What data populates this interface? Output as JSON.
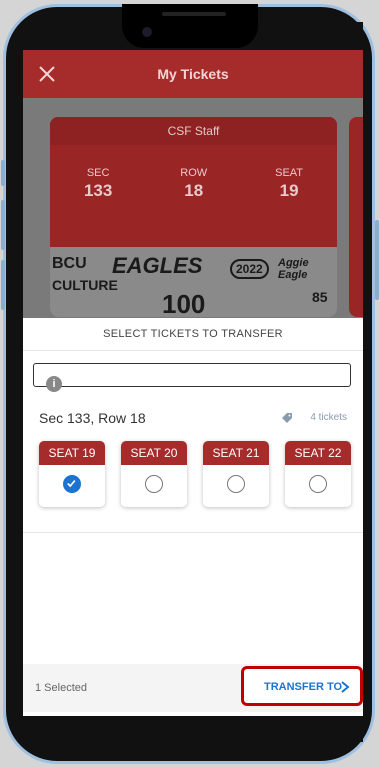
{
  "header": {
    "title": "My Tickets"
  },
  "ticket": {
    "group": "CSF Staff",
    "sec_label": "SEC",
    "sec_value": "133",
    "row_label": "ROW",
    "row_value": "18",
    "seat_label": "SEAT",
    "seat_value": "19",
    "banner_words": [
      "BCU",
      "EAGLES",
      "2022",
      "Aggie Eagle",
      "CULTURE",
      "100",
      "85"
    ]
  },
  "sheet": {
    "title": "SELECT TICKETS TO TRANSFER",
    "row_heading": "Sec 133, Row 18",
    "ticket_count": "4 tickets"
  },
  "seats": [
    {
      "label": "SEAT 19",
      "selected": true
    },
    {
      "label": "SEAT 20",
      "selected": false
    },
    {
      "label": "SEAT 21",
      "selected": false
    },
    {
      "label": "SEAT 22",
      "selected": false
    }
  ],
  "footer": {
    "selected_text": "1 Selected",
    "transfer_label": "TRANSFER TO"
  },
  "colors": {
    "primary": "#a62b2b",
    "accent": "#1c73d1",
    "highlight": "#c00000"
  },
  "icons": [
    "close-icon",
    "info-icon",
    "tag-icon",
    "check-icon",
    "chevron-right-icon"
  ]
}
